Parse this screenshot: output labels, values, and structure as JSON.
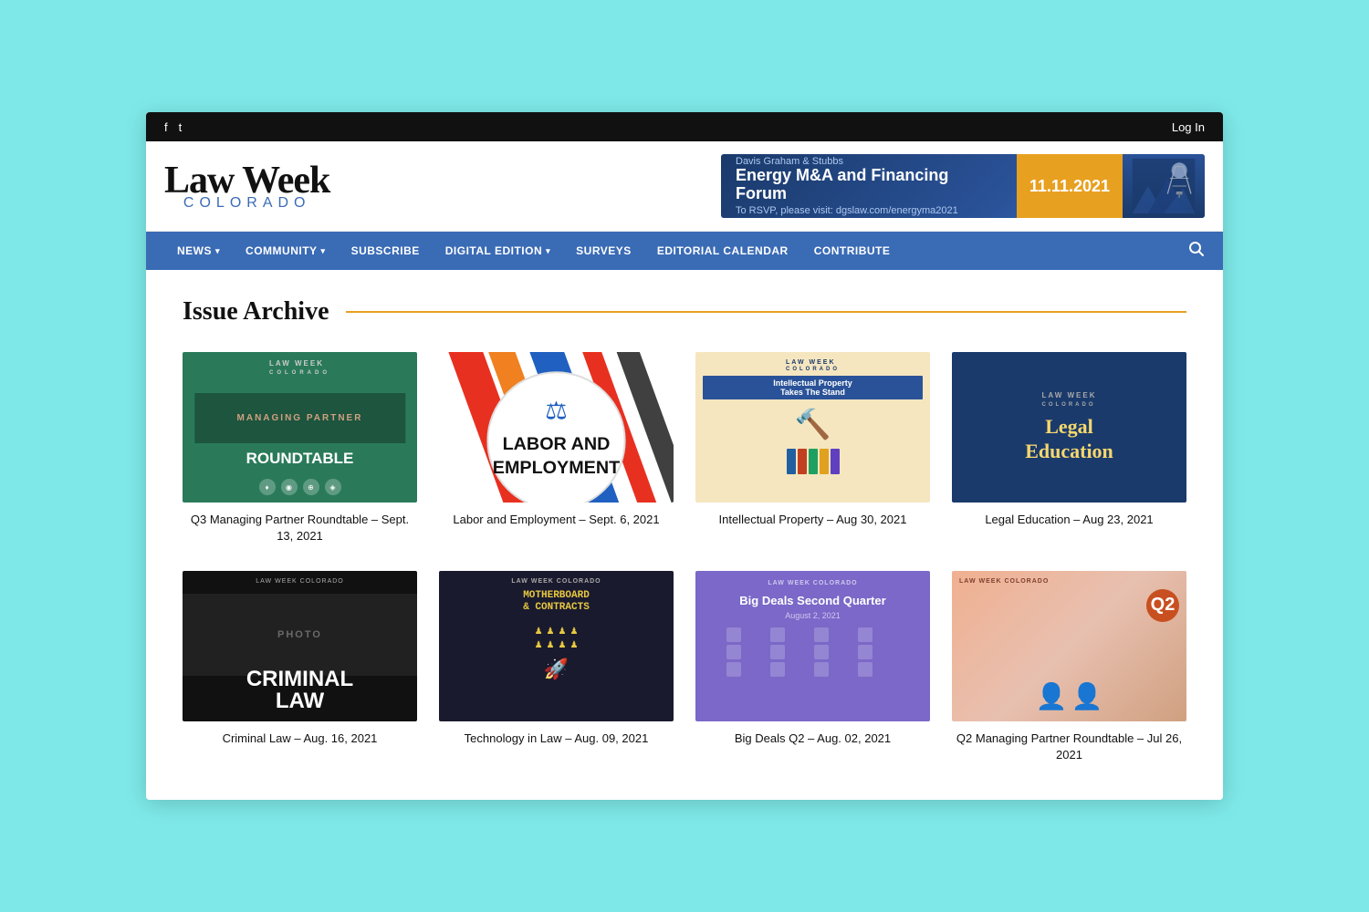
{
  "topbar": {
    "login_label": "Log In",
    "social": [
      {
        "name": "facebook",
        "icon": "f"
      },
      {
        "name": "twitter",
        "icon": "🐦"
      }
    ]
  },
  "header": {
    "logo_lawweek": "Law Week",
    "logo_colorado": "COLORADO",
    "ad": {
      "sponsor": "Davis Graham & Stubbs",
      "title": "Energy M&A and Financing Forum",
      "rsvp": "To RSVP, please visit: dgslaw.com/energyma2021",
      "date": "11.11.2021"
    }
  },
  "nav": {
    "items": [
      {
        "label": "NEWS",
        "has_dropdown": true
      },
      {
        "label": "COMMUNITY",
        "has_dropdown": true
      },
      {
        "label": "SUBSCRIBE",
        "has_dropdown": false
      },
      {
        "label": "DIGITAL EDITION",
        "has_dropdown": true
      },
      {
        "label": "SURVEYS",
        "has_dropdown": false
      },
      {
        "label": "EDITORIAL CALENDAR",
        "has_dropdown": false
      },
      {
        "label": "CONTRIBUTE",
        "has_dropdown": false
      }
    ],
    "search_label": "Search"
  },
  "main": {
    "page_title": "Issue Archive",
    "issues": [
      {
        "id": "q3-managing-partner",
        "title": "Q3 Managing Partner Roundtable – Sept. 13, 2021",
        "cover_type": "q3"
      },
      {
        "id": "labor-employment",
        "title": "Labor and Employment – Sept. 6, 2021",
        "cover_type": "labor"
      },
      {
        "id": "intellectual-property",
        "title": "Intellectual Property – Aug 30, 2021",
        "cover_type": "ip"
      },
      {
        "id": "legal-education",
        "title": "Legal Education – Aug 23, 2021",
        "cover_type": "legal-ed"
      },
      {
        "id": "criminal-law",
        "title": "Criminal Law – Aug. 16, 2021",
        "cover_type": "criminal"
      },
      {
        "id": "technology-in-law",
        "title": "Technology in Law – Aug. 09, 2021",
        "cover_type": "tech"
      },
      {
        "id": "big-deals-q2",
        "title": "Big Deals Q2 – Aug. 02, 2021",
        "cover_type": "bigdeals"
      },
      {
        "id": "q2-managing-partner",
        "title": "Q2 Managing Partner Roundtable – Jul 26, 2021",
        "cover_type": "q2"
      }
    ]
  }
}
